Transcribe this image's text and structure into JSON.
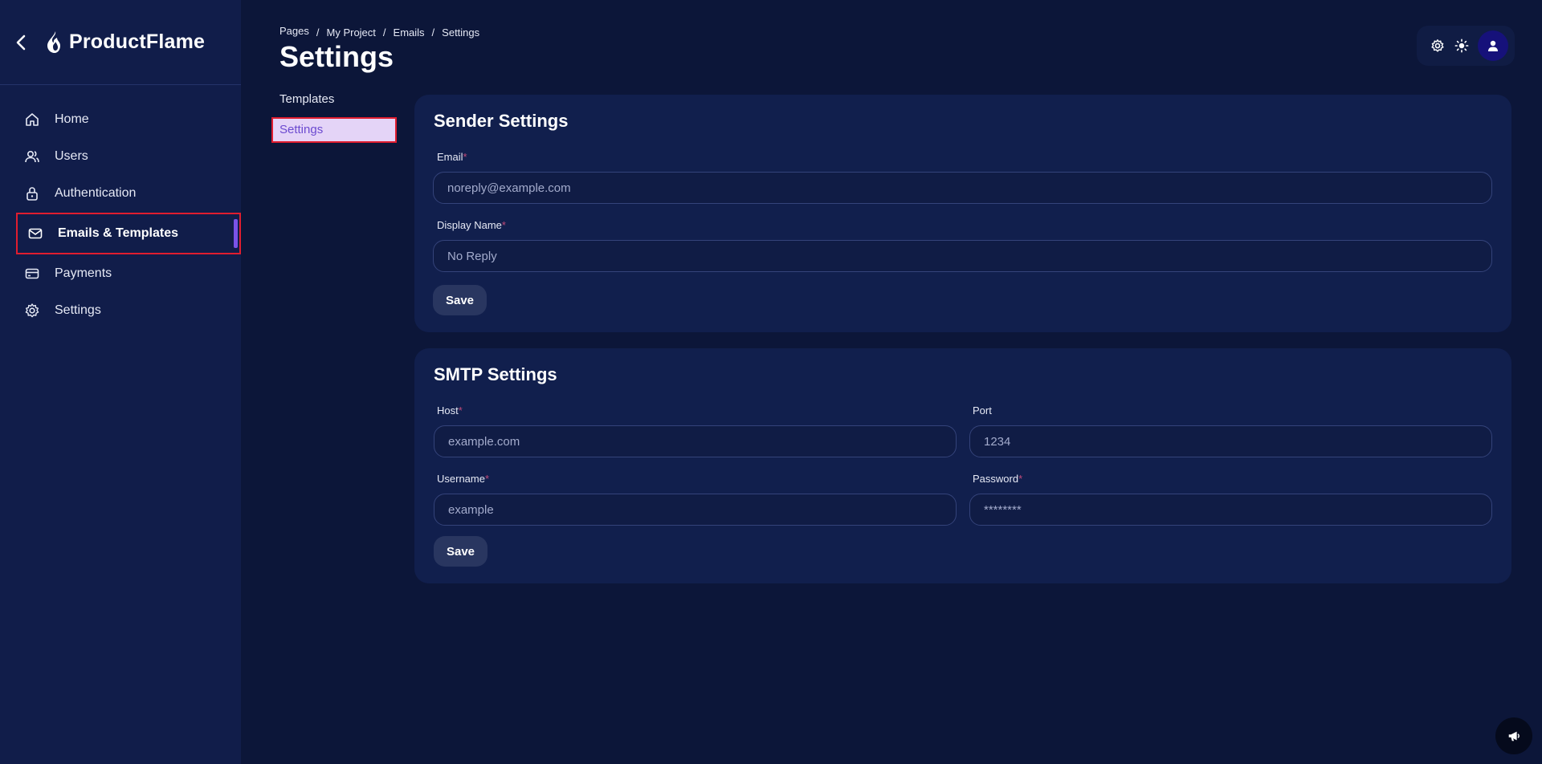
{
  "app": {
    "brand_name": "ProductFlame"
  },
  "sidebar": {
    "items": [
      {
        "label": "Home",
        "icon": "home-icon"
      },
      {
        "label": "Users",
        "icon": "users-icon"
      },
      {
        "label": "Authentication",
        "icon": "lock-icon"
      },
      {
        "label": "Emails & Templates",
        "icon": "mail-icon",
        "active": true
      },
      {
        "label": "Payments",
        "icon": "credit-card-icon"
      },
      {
        "label": "Settings",
        "icon": "gear-icon"
      }
    ]
  },
  "header": {
    "breadcrumb": [
      "Pages",
      "My Project",
      "Emails",
      "Settings"
    ],
    "breadcrumb_separator": "/",
    "title": "Settings"
  },
  "subnav": {
    "items": [
      {
        "label": "Templates"
      },
      {
        "label": "Settings",
        "active": true
      }
    ]
  },
  "sender_settings": {
    "title": "Sender Settings",
    "email_label": "Email",
    "email_placeholder": "noreply@example.com",
    "display_name_label": "Display Name",
    "display_name_placeholder": "No Reply",
    "required_mark": "*",
    "save_label": "Save"
  },
  "smtp_settings": {
    "title": "SMTP Settings",
    "host_label": "Host",
    "host_placeholder": "example.com",
    "port_label": "Port",
    "port_placeholder": "1234",
    "username_label": "Username",
    "username_placeholder": "example",
    "password_label": "Password",
    "password_placeholder": "********",
    "required_mark": "*",
    "save_label": "Save"
  },
  "colors": {
    "background": "#0c1639",
    "sidebar": "#111d4a",
    "card": "#111f4d",
    "accent": "#7a53e8",
    "highlight_border": "#e01d2f",
    "required": "#c04a78"
  }
}
